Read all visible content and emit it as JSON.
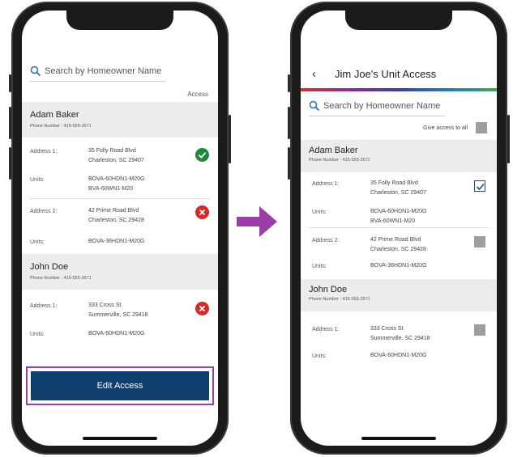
{
  "left_screen": {
    "search_placeholder": "Search by Homeowner Name",
    "access_header": "Access",
    "homeowners": [
      {
        "name": "Adam Baker",
        "phone": "Phone Number : 415-555-2671",
        "addresses": [
          {
            "label": "Address 1:",
            "line1": "35 Folly Road Blvd",
            "line2": "Charleston, SC 29407",
            "units_label": "Units:",
            "unit1": "BOVA-60HDN1-M20G",
            "unit2": "BVA-60WN1-M20",
            "status": "granted"
          },
          {
            "label": "Address 2:",
            "line1": "42 Prime Road Blvd",
            "line2": "Charleston, SC 29428",
            "units_label": "Units:",
            "unit1": "BOVA-36HDN1-M20G",
            "unit2": "",
            "status": "denied"
          }
        ]
      },
      {
        "name": "John Doe",
        "phone": "Phone Number : 415-555-2671",
        "addresses": [
          {
            "label": "Address 1:",
            "line1": "333 Cross St",
            "line2": "Summerville, SC 29418",
            "units_label": "Units:",
            "unit1": "BOVA-60HDN1-M20G",
            "unit2": "",
            "status": "denied"
          }
        ]
      }
    ],
    "edit_button_label": "Edit Access"
  },
  "right_screen": {
    "back_glyph": "‹",
    "title": "Jim Joe's Unit Access",
    "search_placeholder": "Search by Homeowner Name",
    "give_all_label": "Give access to all",
    "give_all_checked": false,
    "homeowners": [
      {
        "name": "Adam Baker",
        "phone": "Phone Number : 415-555-2671",
        "addresses": [
          {
            "label": "Address 1:",
            "line1": "35 Folly Road Blvd",
            "line2": "Charleston, SC 29407",
            "units_label": "Units:",
            "unit1": "BOVA-60HDN1-M20G",
            "unit2": "BVA-60WN1-M20",
            "checked": true
          },
          {
            "label": "Address 2:",
            "line1": "42 Prime Road Blvd",
            "line2": "Charleston, SC 29428",
            "units_label": "Units:",
            "unit1": "BOVA-36HDN1-M20G",
            "unit2": "",
            "checked": false
          }
        ]
      },
      {
        "name": "John Doe",
        "phone": "Phone Number : 415-555-2671",
        "addresses": [
          {
            "label": "Address 1:",
            "line1": "333 Cross St",
            "line2": "Summerville, SC 29418",
            "units_label": "Units:",
            "unit1": "BOVA-60HDN1-M20G",
            "unit2": "",
            "checked": false
          }
        ]
      }
    ]
  },
  "colors": {
    "primary_button": "#0f3f6e",
    "highlight_frame": "#9b3fa6",
    "arrow": "#9b3fa6",
    "granted": "#1f8a3a",
    "denied": "#d32a2a",
    "checkbox_check": "#1e4d80",
    "checkbox_empty": "#9e9e9e"
  },
  "icons": {
    "search": "magnifier-icon",
    "granted": "check-circle-icon",
    "denied": "x-circle-icon",
    "checked": "checkbox-checked-icon",
    "unchecked": "checkbox-empty-icon",
    "flow": "arrow-right-icon"
  }
}
